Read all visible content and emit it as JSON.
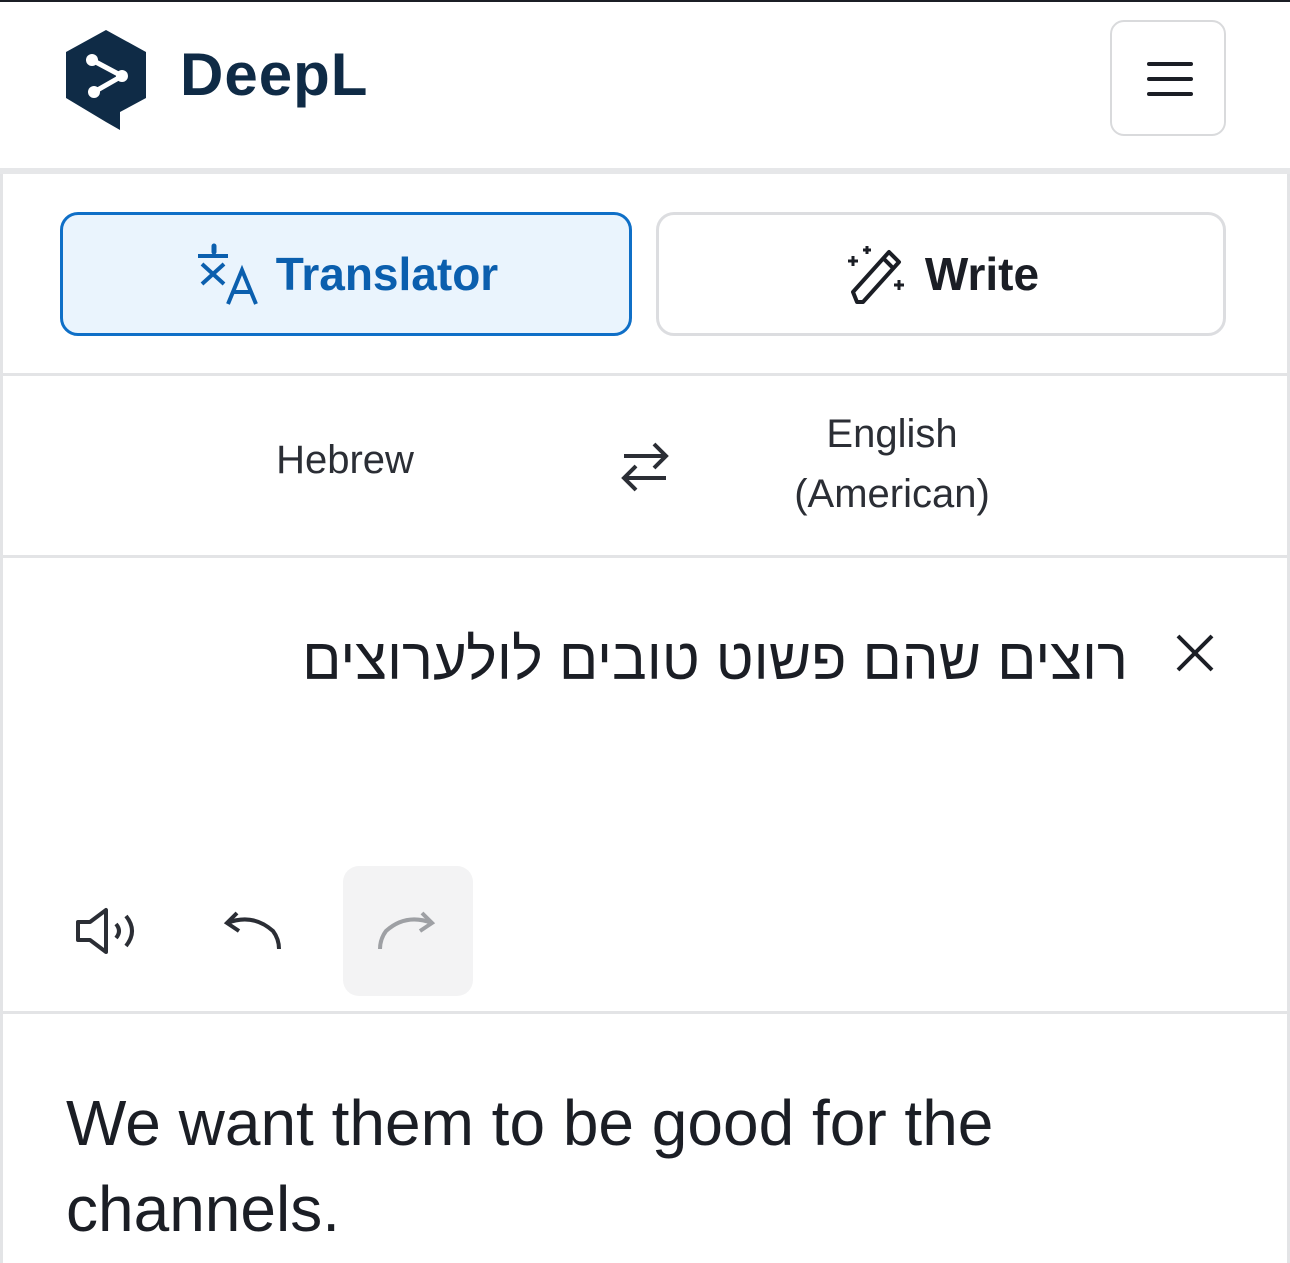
{
  "app": {
    "brand": "DeepL",
    "brand_color": "#0f2b46",
    "menu_icon": "hamburger-menu-icon"
  },
  "mode_tabs": {
    "translator_label": "Translator",
    "translator_icon": "translate-icon",
    "write_label": "Write",
    "write_icon": "magic-pen-icon",
    "active": "Translator",
    "active_color": "#0f6fc7"
  },
  "languages": {
    "source": "Hebrew",
    "target": "English (American)",
    "swap_icon": "swap-arrows-icon"
  },
  "source_panel": {
    "text": "רוצים שהם פשוט טובים לולערוצים",
    "clear_icon": "close-icon",
    "tools": [
      "speaker-icon",
      "undo-icon",
      "redo-icon"
    ]
  },
  "target_panel": {
    "text": "We want them to be good for the channels."
  }
}
